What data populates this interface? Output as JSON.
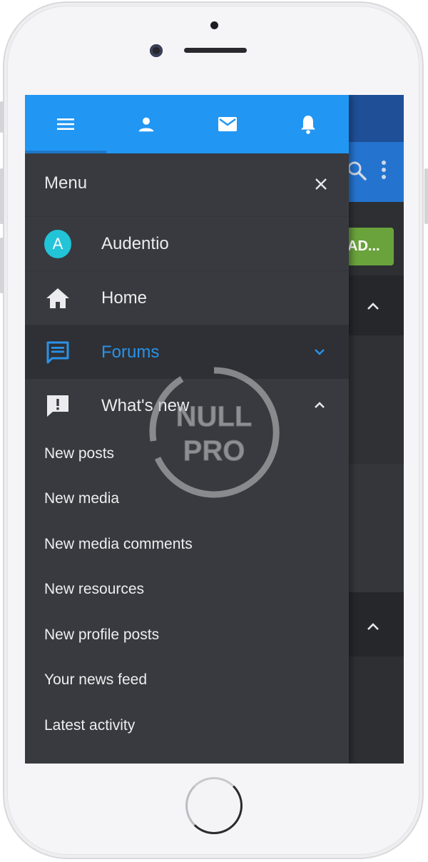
{
  "drawer": {
    "title": "Menu",
    "tabs": [
      {
        "icon": "menu-icon",
        "active": true
      },
      {
        "icon": "user-icon",
        "active": false
      },
      {
        "icon": "mail-icon",
        "active": false
      },
      {
        "icon": "bell-icon",
        "active": false
      }
    ],
    "items": [
      {
        "label": "Audentio",
        "icon": "avatar",
        "avatar_letter": "A"
      },
      {
        "label": "Home",
        "icon": "home-icon"
      },
      {
        "label": "Forums",
        "icon": "forum-icon",
        "active": true,
        "expanded": false
      },
      {
        "label": "What's new",
        "icon": "whats-new-icon",
        "expanded": true
      }
    ],
    "submenu": [
      "New posts",
      "New media",
      "New media comments",
      "New resources",
      "New profile posts",
      "Your news feed",
      "Latest activity"
    ]
  },
  "background_app": {
    "button_label": "AD..."
  },
  "watermark": {
    "line1": "NULL",
    "line2": "PRO"
  },
  "colors": {
    "tab_bar": "#2196f3",
    "drawer_bg": "#383a3f",
    "active_text": "#2a92e8",
    "avatar": "#22c4d8",
    "bg_button": "#6aa33c"
  }
}
